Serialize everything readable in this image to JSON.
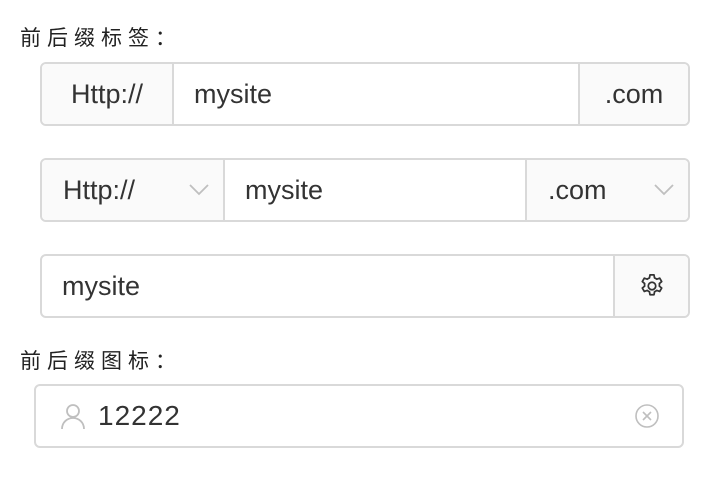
{
  "sections": {
    "addon_label": "前后缀标签：",
    "icon_label": "前后缀图标："
  },
  "addon_input": {
    "prefix": "Http://",
    "value": "mysite",
    "suffix": ".com"
  },
  "select_input": {
    "prefix_selected": "Http://",
    "value": "mysite",
    "suffix_selected": ".com"
  },
  "settings_input": {
    "value": "mysite",
    "suffix_icon": "gear-icon"
  },
  "icon_input": {
    "prefix_icon": "user-icon",
    "value": "12222",
    "clear_icon": "close-circle-icon"
  },
  "colors": {
    "border": "#d9d9d9",
    "addon_bg": "#fafafa",
    "text": "#333333",
    "icon": "#bfbfbf"
  }
}
